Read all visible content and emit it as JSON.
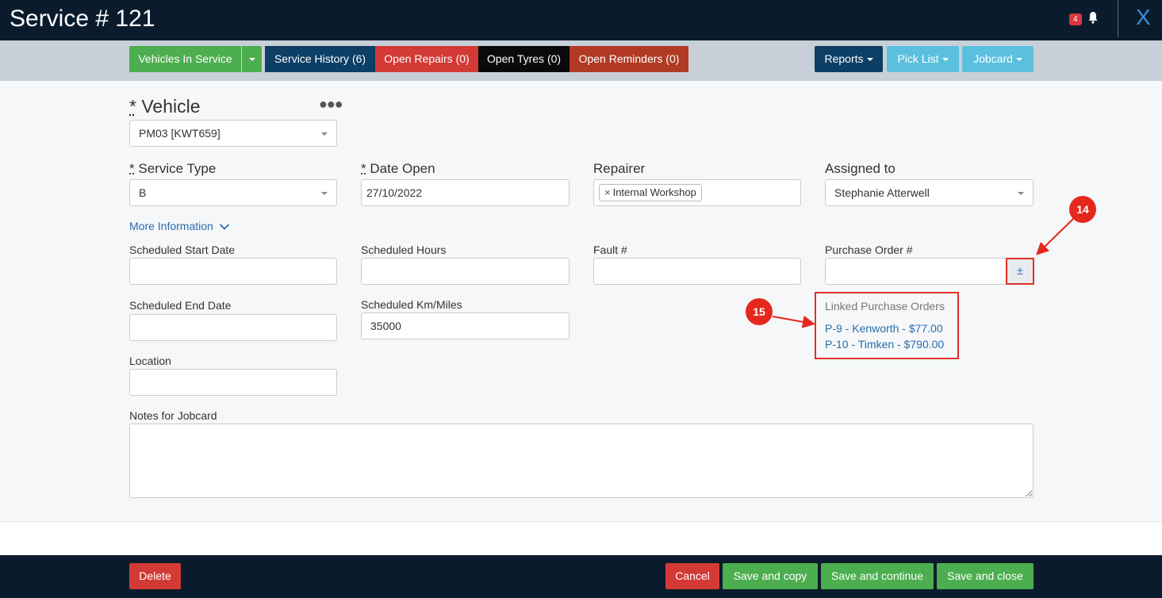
{
  "header": {
    "title": "Service # 121",
    "notification_count": "4",
    "close_label": "X"
  },
  "tabs": {
    "vehicles_in_service": "Vehicles In Service",
    "service_history": "Service History (6)",
    "open_repairs": "Open Repairs (0)",
    "open_tyres": "Open Tyres (0)",
    "open_reminders": "Open Reminders (0)",
    "reports": "Reports",
    "pick_list": "Pick List",
    "jobcard": "Jobcard"
  },
  "form": {
    "vehicle_label": "Vehicle",
    "required_mark": "*",
    "vehicle_value": "PM03 [KWT659]",
    "service_type_label": "Service Type",
    "service_type_value": "B",
    "date_open_label": "Date Open",
    "date_open_value": "27/10/2022",
    "repairer_label": "Repairer",
    "repairer_tag": "Internal Workshop",
    "tag_remove": "×",
    "assigned_to_label": "Assigned to",
    "assigned_to_value": "Stephanie Atterwell",
    "more_information": "More Information",
    "scheduled_start_label": "Scheduled Start Date",
    "scheduled_hours_label": "Scheduled Hours",
    "fault_label": "Fault #",
    "purchase_order_label": "Purchase Order #",
    "purchase_order_button": "±",
    "scheduled_end_label": "Scheduled End Date",
    "scheduled_km_label": "Scheduled Km/Miles",
    "scheduled_km_value": "35000",
    "location_label": "Location",
    "notes_label": "Notes for Jobcard"
  },
  "linked_purchase_orders": {
    "title": "Linked Purchase Orders",
    "items": [
      "P-9 - Kenworth - $77.00",
      "P-10 - Timken - $790.00"
    ]
  },
  "callouts": {
    "c14": "14",
    "c15": "15"
  },
  "footer": {
    "delete": "Delete",
    "cancel": "Cancel",
    "save_copy": "Save and copy",
    "save_continue": "Save and continue",
    "save_close": "Save and close"
  },
  "colors": {
    "header_bg": "#0a1c2c",
    "green": "#4cae4f",
    "navy": "#0c3e66",
    "red": "#d33a35",
    "brown": "#b23a25",
    "light_blue": "#5bc0de",
    "callout_red": "#e5271d"
  },
  "icons": {
    "bell": "bell-icon",
    "more": "ellipsis-icon",
    "chevron": "chevron-down-icon"
  }
}
